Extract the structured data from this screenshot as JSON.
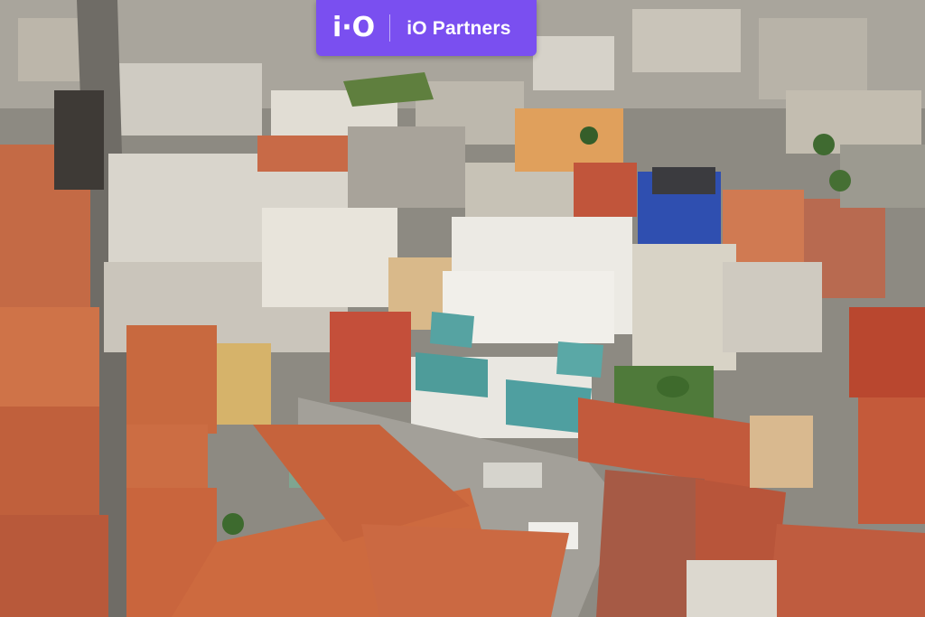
{
  "badge": {
    "logo_mark": "i·O",
    "brand_name": "iO Partners",
    "color": "#7a4ff0"
  },
  "photo": {
    "subject": "aerial-city-view"
  }
}
